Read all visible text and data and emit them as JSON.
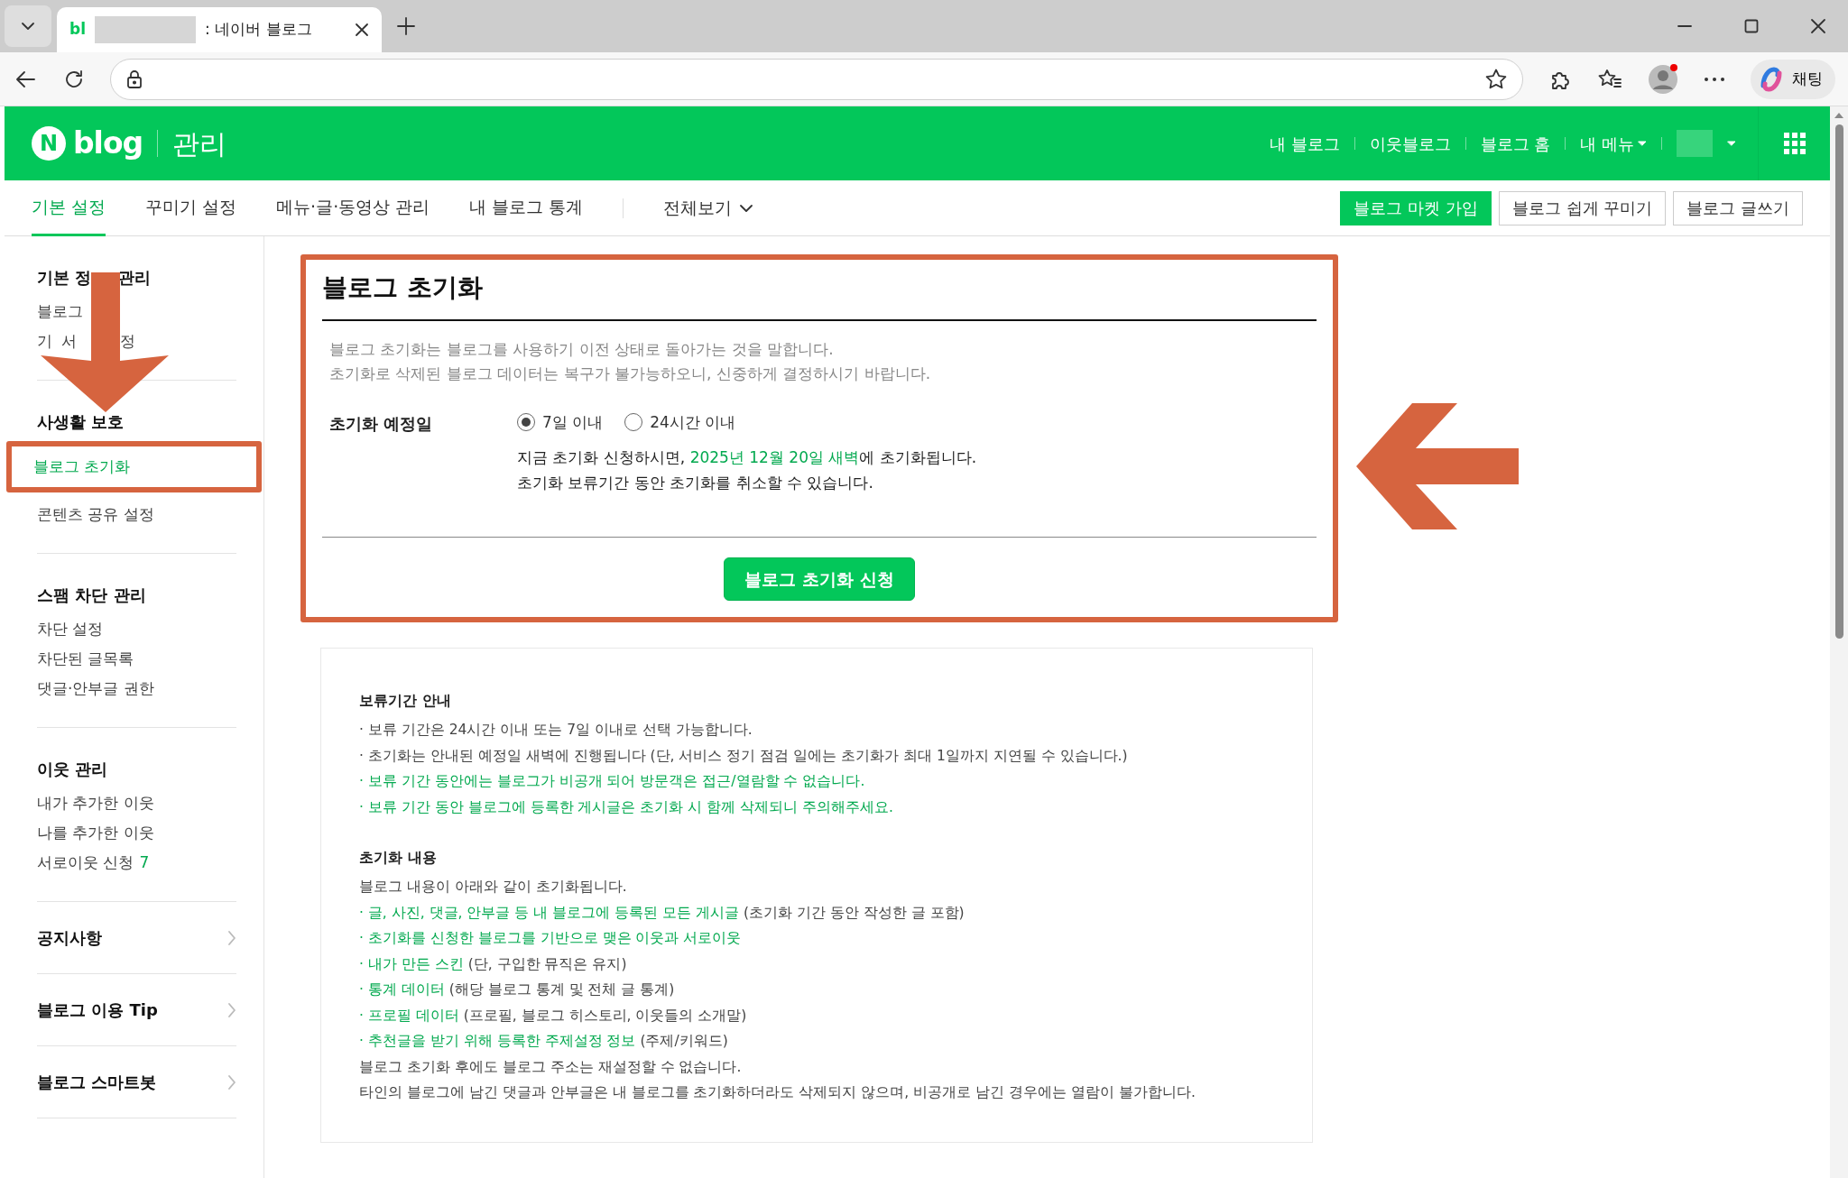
{
  "browser": {
    "tab": {
      "favicon": "bl",
      "title": ": 네이버 블로그"
    },
    "copilot": "채팅"
  },
  "header": {
    "logo_badge": "N",
    "logo": "blog",
    "section": "관리",
    "links": [
      {
        "label": "내 블로그",
        "dropdown": false
      },
      {
        "label": "이웃블로그",
        "dropdown": false
      },
      {
        "label": "블로그 홈",
        "dropdown": false
      },
      {
        "label": "내 메뉴",
        "dropdown": true
      }
    ]
  },
  "nav": {
    "tabs": [
      {
        "label": "기본 설정",
        "selected": true
      },
      {
        "label": "꾸미기 설정",
        "selected": false
      },
      {
        "label": "메뉴·글·동영상 관리",
        "selected": false
      },
      {
        "label": "내 블로그 통계",
        "selected": false
      }
    ],
    "all_view": "전체보기",
    "buttons": [
      {
        "label": "블로그 마켓 가입",
        "kind": "primary"
      },
      {
        "label": "블로그 쉽게 꾸미기",
        "kind": "outline"
      },
      {
        "label": "블로그 글쓰기",
        "kind": "outline"
      }
    ]
  },
  "sidebar": {
    "sections": [
      {
        "title": [
          "기본 정",
          "관리"
        ],
        "items": [
          {
            "parts": [
              "블로그"
            ],
            "selected": false,
            "highlighted": false
          },
          {
            "parts": [
              "기",
              "서",
              "정"
            ],
            "selected": false,
            "highlighted": false
          }
        ]
      },
      {
        "title": [
          "사생활 보호"
        ],
        "items": [
          {
            "parts": [
              "블로그 초기화"
            ],
            "selected": true,
            "highlighted": true
          },
          {
            "parts": [
              "콘텐츠 공유 설정"
            ],
            "selected": false,
            "highlighted": false
          }
        ]
      },
      {
        "title": [
          "스팸 차단 관리"
        ],
        "items": [
          {
            "parts": [
              "차단 설정"
            ],
            "selected": false,
            "highlighted": false
          },
          {
            "parts": [
              "차단된 글목록"
            ],
            "selected": false,
            "highlighted": false
          },
          {
            "parts": [
              "댓글·안부글 권한"
            ],
            "selected": false,
            "highlighted": false
          }
        ]
      },
      {
        "title": [
          "이웃 관리"
        ],
        "items": [
          {
            "parts": [
              "내가 추가한 이웃"
            ],
            "selected": false,
            "highlighted": false
          },
          {
            "parts": [
              "나를 추가한 이웃"
            ],
            "selected": false,
            "highlighted": false
          },
          {
            "parts": [
              "서로이웃 신청"
            ],
            "count": "7",
            "selected": false,
            "highlighted": false
          }
        ]
      }
    ],
    "links": [
      {
        "label": "공지사항"
      },
      {
        "label": "블로그 이용 Tip"
      },
      {
        "label": "블로그 스마트봇"
      }
    ]
  },
  "reset": {
    "highlighted": true,
    "title": "블로그 초기화",
    "description": [
      "블로그 초기화는 블로그를 사용하기 이전 상태로 돌아가는 것을 말합니다.",
      "초기화로 삭제된 블로그 데이터는 복구가 불가능하오니, 신중하게 결정하시기 바랍니다."
    ],
    "field_label": "초기화 예정일",
    "options": [
      {
        "label": "7일 이내",
        "selected": true
      },
      {
        "label": "24시간 이내",
        "selected": false
      }
    ],
    "notice": [
      [
        {
          "text": "지금 초기화 신청하시면, ",
          "highlight": false
        },
        {
          "text": "2025년 12월 20일 새벽",
          "highlight": true
        },
        {
          "text": "에 초기화됩니다.",
          "highlight": false
        }
      ],
      [
        {
          "text": "초기화 보류기간 동안 초기화를 취소할 수 있습니다.",
          "highlight": false
        }
      ]
    ],
    "submit": "블로그 초기화 신청"
  },
  "info": {
    "sections": [
      {
        "title": "보류기간 안내",
        "lines": [
          [
            {
              "text": "· 보류 기간은 24시간 이내 또는 7일 이내로 선택 가능합니다.",
              "highlight": false
            }
          ],
          [
            {
              "text": "· 초기화는 안내된 예정일 새벽에 진행됩니다 (단, 서비스 정기 점검 일에는 초기화가 최대 1일까지 지연될 수 있습니다.)",
              "highlight": false
            }
          ],
          [
            {
              "text": "· 보류 기간 동안에는 블로그가 비공개 되어 방문객은 접근/열람할 수 없습니다.",
              "highlight": true
            }
          ],
          [
            {
              "text": "· 보류 기간 동안 블로그에 등록한 게시글은 초기화 시 함께 삭제되니 주의해주세요.",
              "highlight": true
            }
          ]
        ]
      },
      {
        "title": "초기화 내용",
        "lines": [
          [
            {
              "text": "블로그 내용이 아래와 같이 초기화됩니다.",
              "highlight": false
            }
          ],
          [
            {
              "text": "· 글, 사진, 댓글, 안부글 등 내 블로그에 등록된 모든 게시글",
              "highlight": true
            },
            {
              "text": " (초기화 기간 동안 작성한 글 포함)",
              "highlight": false
            }
          ],
          [
            {
              "text": "· 초기화를 신청한 블로그를 기반으로 맺은 이웃과 서로이웃",
              "highlight": true
            }
          ],
          [
            {
              "text": "· 내가 만든 스킨",
              "highlight": true
            },
            {
              "text": " (단, 구입한 뮤직은 유지)",
              "highlight": false
            }
          ],
          [
            {
              "text": "· 통계 데이터",
              "highlight": true
            },
            {
              "text": " (해당 블로그 통계 및 전체 글 통계)",
              "highlight": false
            }
          ],
          [
            {
              "text": "· 프로필 데이터",
              "highlight": true
            },
            {
              "text": " (프로필, 블로그 히스토리, 이웃들의 소개말)",
              "highlight": false
            }
          ],
          [
            {
              "text": "· 추천글을 받기 위해 등록한 주제설정 정보",
              "highlight": true
            },
            {
              "text": " (주제/키워드)",
              "highlight": false
            }
          ],
          [
            {
              "text": "블로그 초기화 후에도 블로그 주소는 재설정할 수 없습니다.",
              "highlight": false
            }
          ],
          [
            {
              "text": "타인의 블로그에 남긴 댓글과 안부글은 내 블로그를 초기화하더라도 삭제되지 않으며, 비공개로 남긴 경우에는 열람이 불가합니다.",
              "highlight": false
            }
          ]
        ]
      }
    ]
  }
}
